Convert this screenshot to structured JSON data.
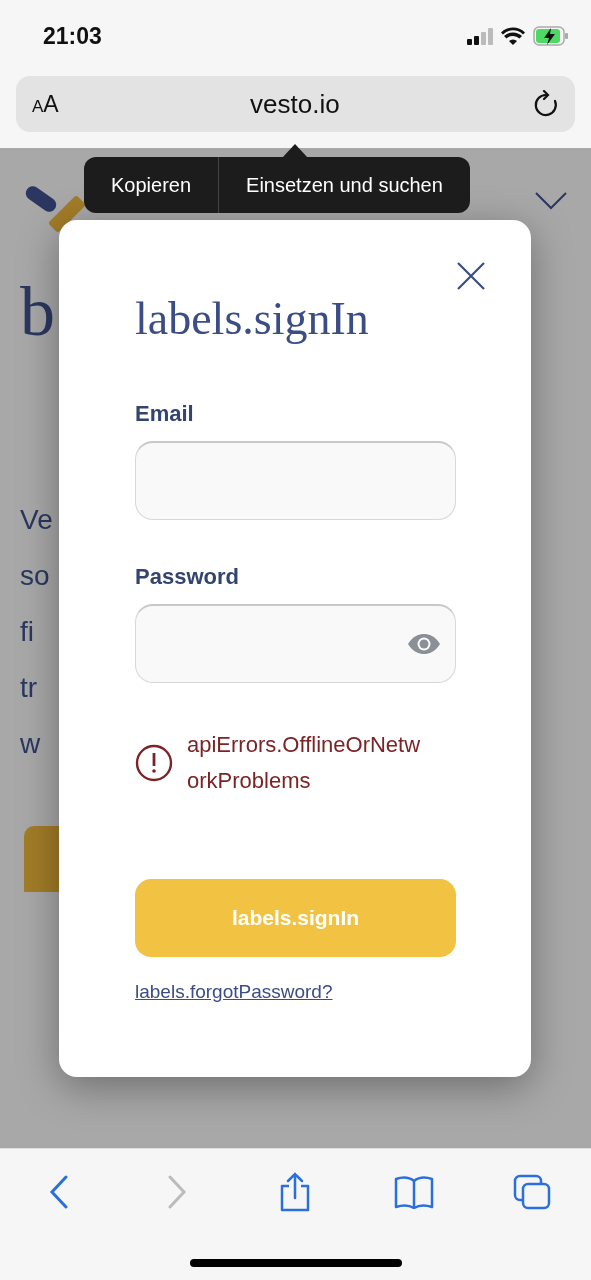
{
  "status_bar": {
    "time": "21:03"
  },
  "address_bar": {
    "text_size_button": "AA",
    "url": "vesto.io"
  },
  "context_menu": {
    "items": [
      "Kopieren",
      "Einsetzen und suchen"
    ]
  },
  "background_page": {
    "heading_lines": [
      "b"
    ],
    "paragraph_lines": [
      "Ve",
      "so",
      "fi",
      "tr",
      "w"
    ]
  },
  "dialog": {
    "title": "labels.signIn",
    "fields": [
      {
        "kind": "text",
        "label": "Email"
      },
      {
        "kind": "password",
        "label": "Password"
      }
    ],
    "error": "apiErrors.OfflineOrNetworkProblems",
    "submit": "labels.signIn",
    "link": "labels.forgotPassword?"
  },
  "toolbar": {
    "back_disabled": false,
    "forward_disabled": true
  }
}
